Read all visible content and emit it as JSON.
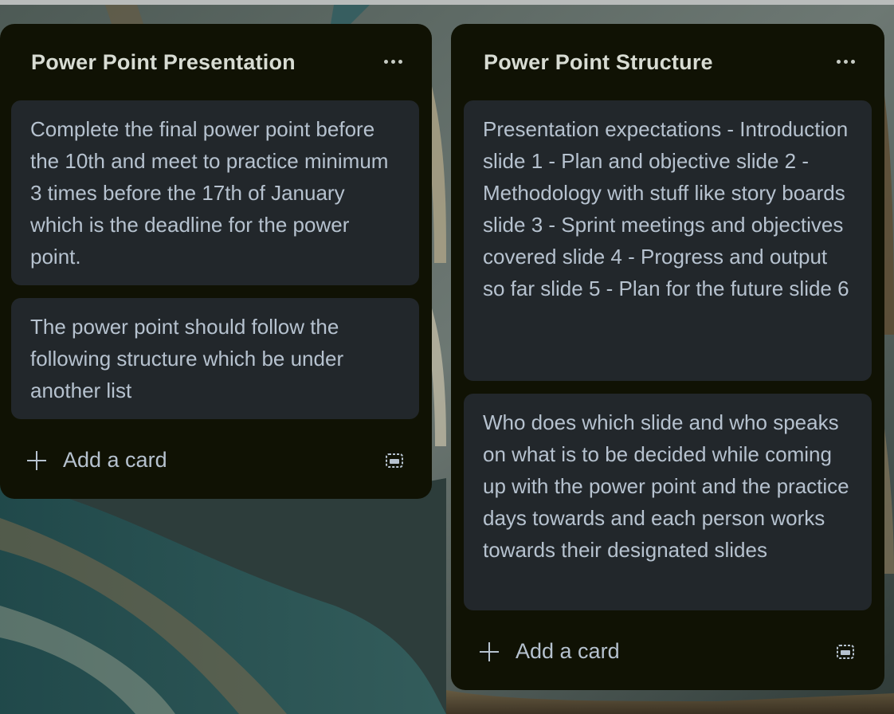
{
  "lists": [
    {
      "title": "Power Point Presentation",
      "cards": [
        "Complete the final power point before the 10th and meet to practice minimum 3 times before the 17th of January which is the deadline for the power point.",
        "The power point should follow the following structure which be under another list"
      ],
      "add_card_label": "Add a card"
    },
    {
      "title": "Power Point Structure",
      "cards": [
        "Presentation expectations - Introduction slide 1 - Plan and objective slide 2 - Methodology with stuff like story boards slide 3 - Sprint meetings and objectives covered slide 4 - Progress and output so far slide 5 - Plan for the future slide 6",
        "Who does which slide and who speaks on what is to be decided while coming up with the power point and the practice days towards and each person works towards their designated slides"
      ],
      "add_card_label": "Add a card"
    }
  ],
  "icons": {
    "list_menu": "more-horizontal-icon",
    "add": "plus-icon",
    "template": "card-template-icon"
  },
  "colors": {
    "list_bg": "#101204",
    "card_bg": "#22272b",
    "text": "#b6c2cf",
    "title": "#d8dcd3"
  }
}
